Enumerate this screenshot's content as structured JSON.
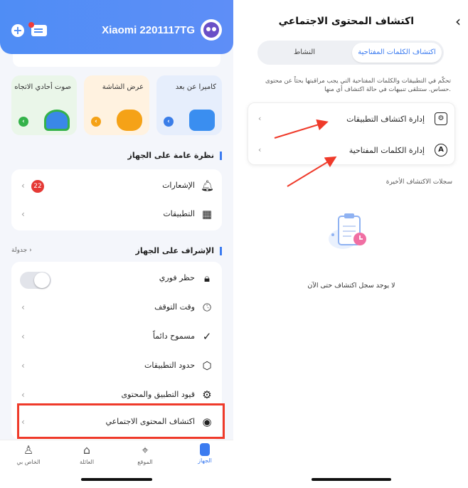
{
  "left": {
    "header": {
      "device_name": "Xiaomi 2201117TG"
    },
    "cards": [
      {
        "label": "كاميرا عن بعد",
        "icon": "camera-icon"
      },
      {
        "label": "عرض الشاشة",
        "icon": "binoculars-icon"
      },
      {
        "label": "صوت أحادي الاتجاه",
        "icon": "headphones-icon"
      }
    ],
    "overview": {
      "title": "نظرة عامة على الجهاز",
      "items": [
        {
          "label": "الإشعارات",
          "icon": "bell-icon",
          "badge": "22"
        },
        {
          "label": "التطبيقات",
          "icon": "apps-grid-icon"
        }
      ]
    },
    "supervision": {
      "title": "الإشراف على الجهاز",
      "link": "جدولة",
      "items": [
        {
          "label": "حظر فوري",
          "icon": "lock-icon"
        },
        {
          "label": "وقت التوقف",
          "icon": "clock-icon"
        },
        {
          "label": "مسموح دائماً",
          "icon": "check-shield-icon"
        },
        {
          "label": "حدود التطبيقات",
          "icon": "app-limit-icon"
        },
        {
          "label": "قيود التطبيق والمحتوى",
          "icon": "restriction-icon"
        },
        {
          "label": "اكتشاف المحتوى الاجتماعي",
          "icon": "eye-icon"
        }
      ]
    },
    "tabbar": [
      {
        "label": "الجهاز",
        "icon": "phone-icon",
        "active": true
      },
      {
        "label": "الموقع",
        "icon": "location-icon"
      },
      {
        "label": "العائلة",
        "icon": "home-icon"
      },
      {
        "label": "الخاص بي",
        "icon": "person-icon"
      }
    ]
  },
  "right": {
    "title": "اكتشاف المحتوى الاجتماعي",
    "segments": {
      "active": "اكتشاف الكلمات المفتاحية",
      "inactive": "النشاط"
    },
    "description": "تحكّم في التطبيقات والكلمات المفتاحية التي يجب مراقبتها بحثاً عن محتوى حساس. ستتلقى تنبيهات في حالة اكتشاف أي منها.",
    "items": [
      {
        "label": "إدارة اكتشاف التطبيقات",
        "icon": "gear-icon"
      },
      {
        "label": "إدارة الكلمات المفتاحية",
        "icon": "letter-a-icon"
      }
    ],
    "recent_title": "سجلات الاكتشاف الأخيرة",
    "empty_text": "لا يوجد سجل اكتشاف حتى الآن"
  },
  "colors": {
    "accent": "#3b7bf0",
    "header": "#5b8ff6",
    "highlight": "#ef3a2a",
    "badge": "#e53935"
  }
}
